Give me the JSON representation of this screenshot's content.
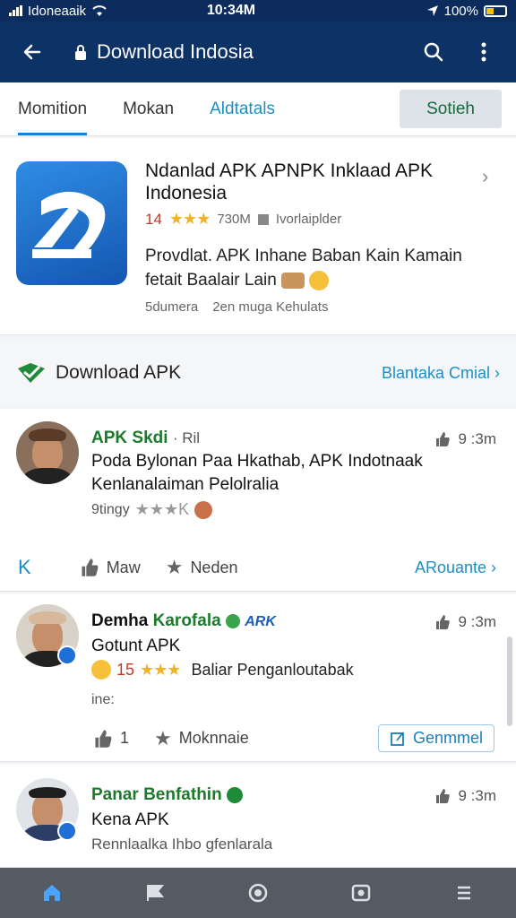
{
  "status": {
    "carrier": "Idoneaaik",
    "time": "10:34M",
    "battery": "100%"
  },
  "app_bar": {
    "title": "Download Indosia"
  },
  "tabs": [
    {
      "label": "Momition"
    },
    {
      "label": "Mokan"
    },
    {
      "label": "Aldtatals"
    },
    {
      "label": "Sotieh"
    }
  ],
  "app": {
    "title": "Ndanlad APK APNPK Inklaad APK Indonesia",
    "rating_value": "14",
    "stars": "★★★",
    "size": "730M",
    "source": "Ivorlaiplder",
    "description": "Provdlat. APK Inhane Baban Kain Kamain fetait Baalair Lain",
    "footer_left": "5dumera",
    "footer_right": "2en muga Kehulats"
  },
  "section": {
    "label": "Download APK",
    "link": "Blantaka Cmial"
  },
  "comments": [
    {
      "name": "APK Skdi",
      "tag": "· Ril",
      "time": "9 :3m",
      "text": "Poda Bylonan Paa Hkathab, APK Indotnaak Kenlanalaiman Pelolralia",
      "sub": "9tingy",
      "stars": "★★★K",
      "like": "Maw",
      "fav": "Neden",
      "more": "ARouante"
    },
    {
      "name": "Demha",
      "name2": "Karofala",
      "badge": "ARK",
      "time": "9 :3m",
      "text": "Gotunt APK",
      "rating": "15",
      "stars": "★★★",
      "sub_text": "Baliar Penganloutabak",
      "extra": "ine:",
      "like_count": "1",
      "fav": "Moknnaie",
      "button": "Genmmel"
    },
    {
      "name": "Panar Benfathin",
      "time": "9 :3m",
      "text": "Kena APK",
      "sub": "Rennlaalka Ihbo gfenlarala"
    }
  ],
  "icons": {
    "back": "back-arrow-icon",
    "lock": "lock-icon",
    "search": "search-icon",
    "more": "more-vert-icon"
  },
  "colors": {
    "app_bar": "#0c3266",
    "accent": "#1a8fc6",
    "green": "#1c7a2b",
    "nav": "#555b63"
  }
}
